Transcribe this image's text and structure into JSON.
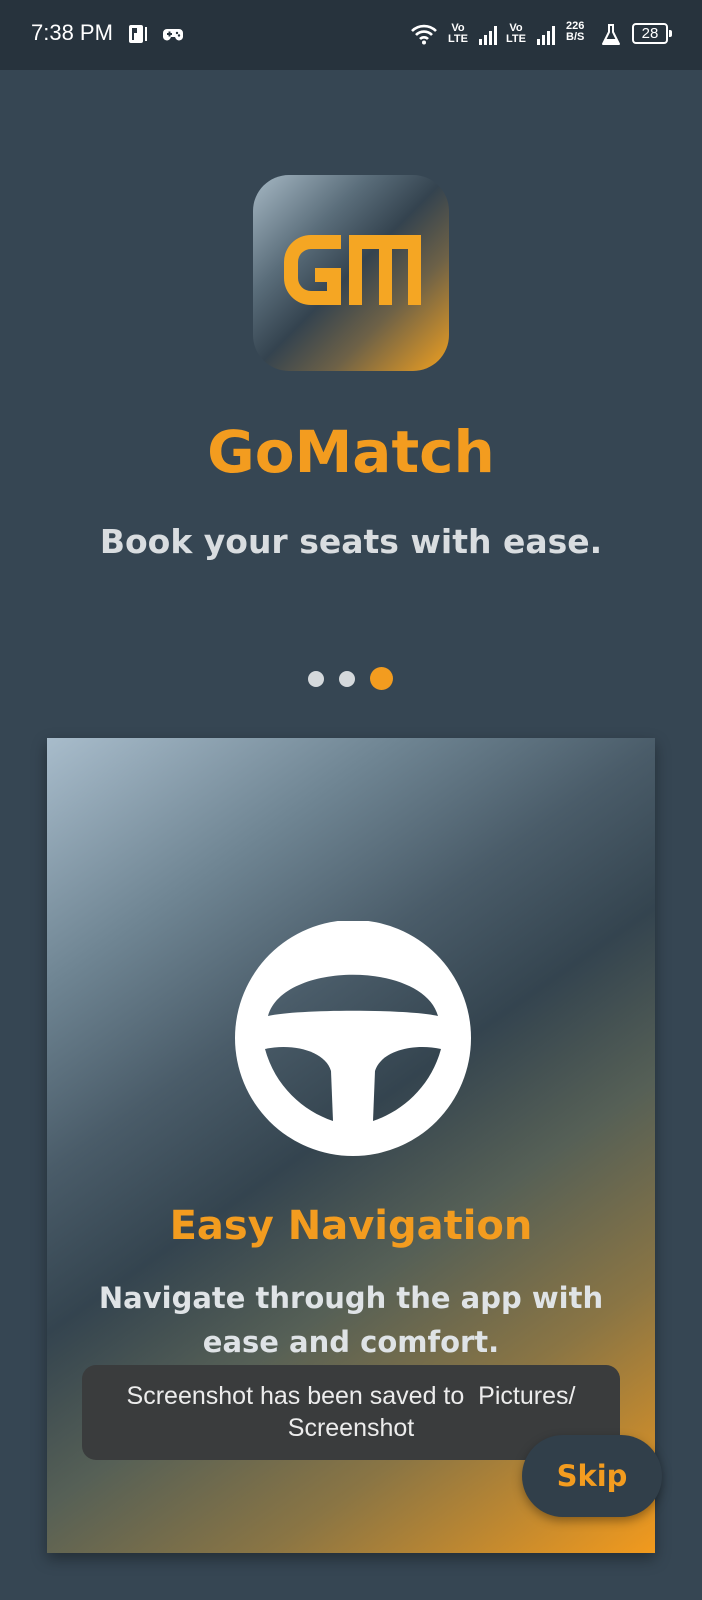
{
  "status_bar": {
    "time": "7:38 PM",
    "net_speed_value": "226",
    "net_speed_unit": "B/S",
    "volte1_top": "Vo",
    "volte1_bottom": "LTE",
    "volte2_top": "Vo",
    "volte2_bottom": "LTE",
    "battery": "28",
    "icons": [
      "parking-icon",
      "gamepad-icon",
      "wifi-icon",
      "signal-icon",
      "signal-icon",
      "flask-icon",
      "battery-icon"
    ]
  },
  "app": {
    "logo_letters": "GM",
    "title": "GoMatch",
    "tagline": "Book your seats with ease."
  },
  "pager": {
    "total": 3,
    "active_index": 2
  },
  "card": {
    "icon": "steering-wheel-icon",
    "title": "Easy Navigation",
    "description": "Navigate through the app with ease and comfort."
  },
  "toast": {
    "message_line1": "Screenshot has been saved to  Pictures/",
    "message_line2": "Screenshot"
  },
  "skip_button": {
    "label": "Skip"
  },
  "colors": {
    "accent": "#f39c1f",
    "background": "#364653",
    "status_bar": "#27333d"
  }
}
